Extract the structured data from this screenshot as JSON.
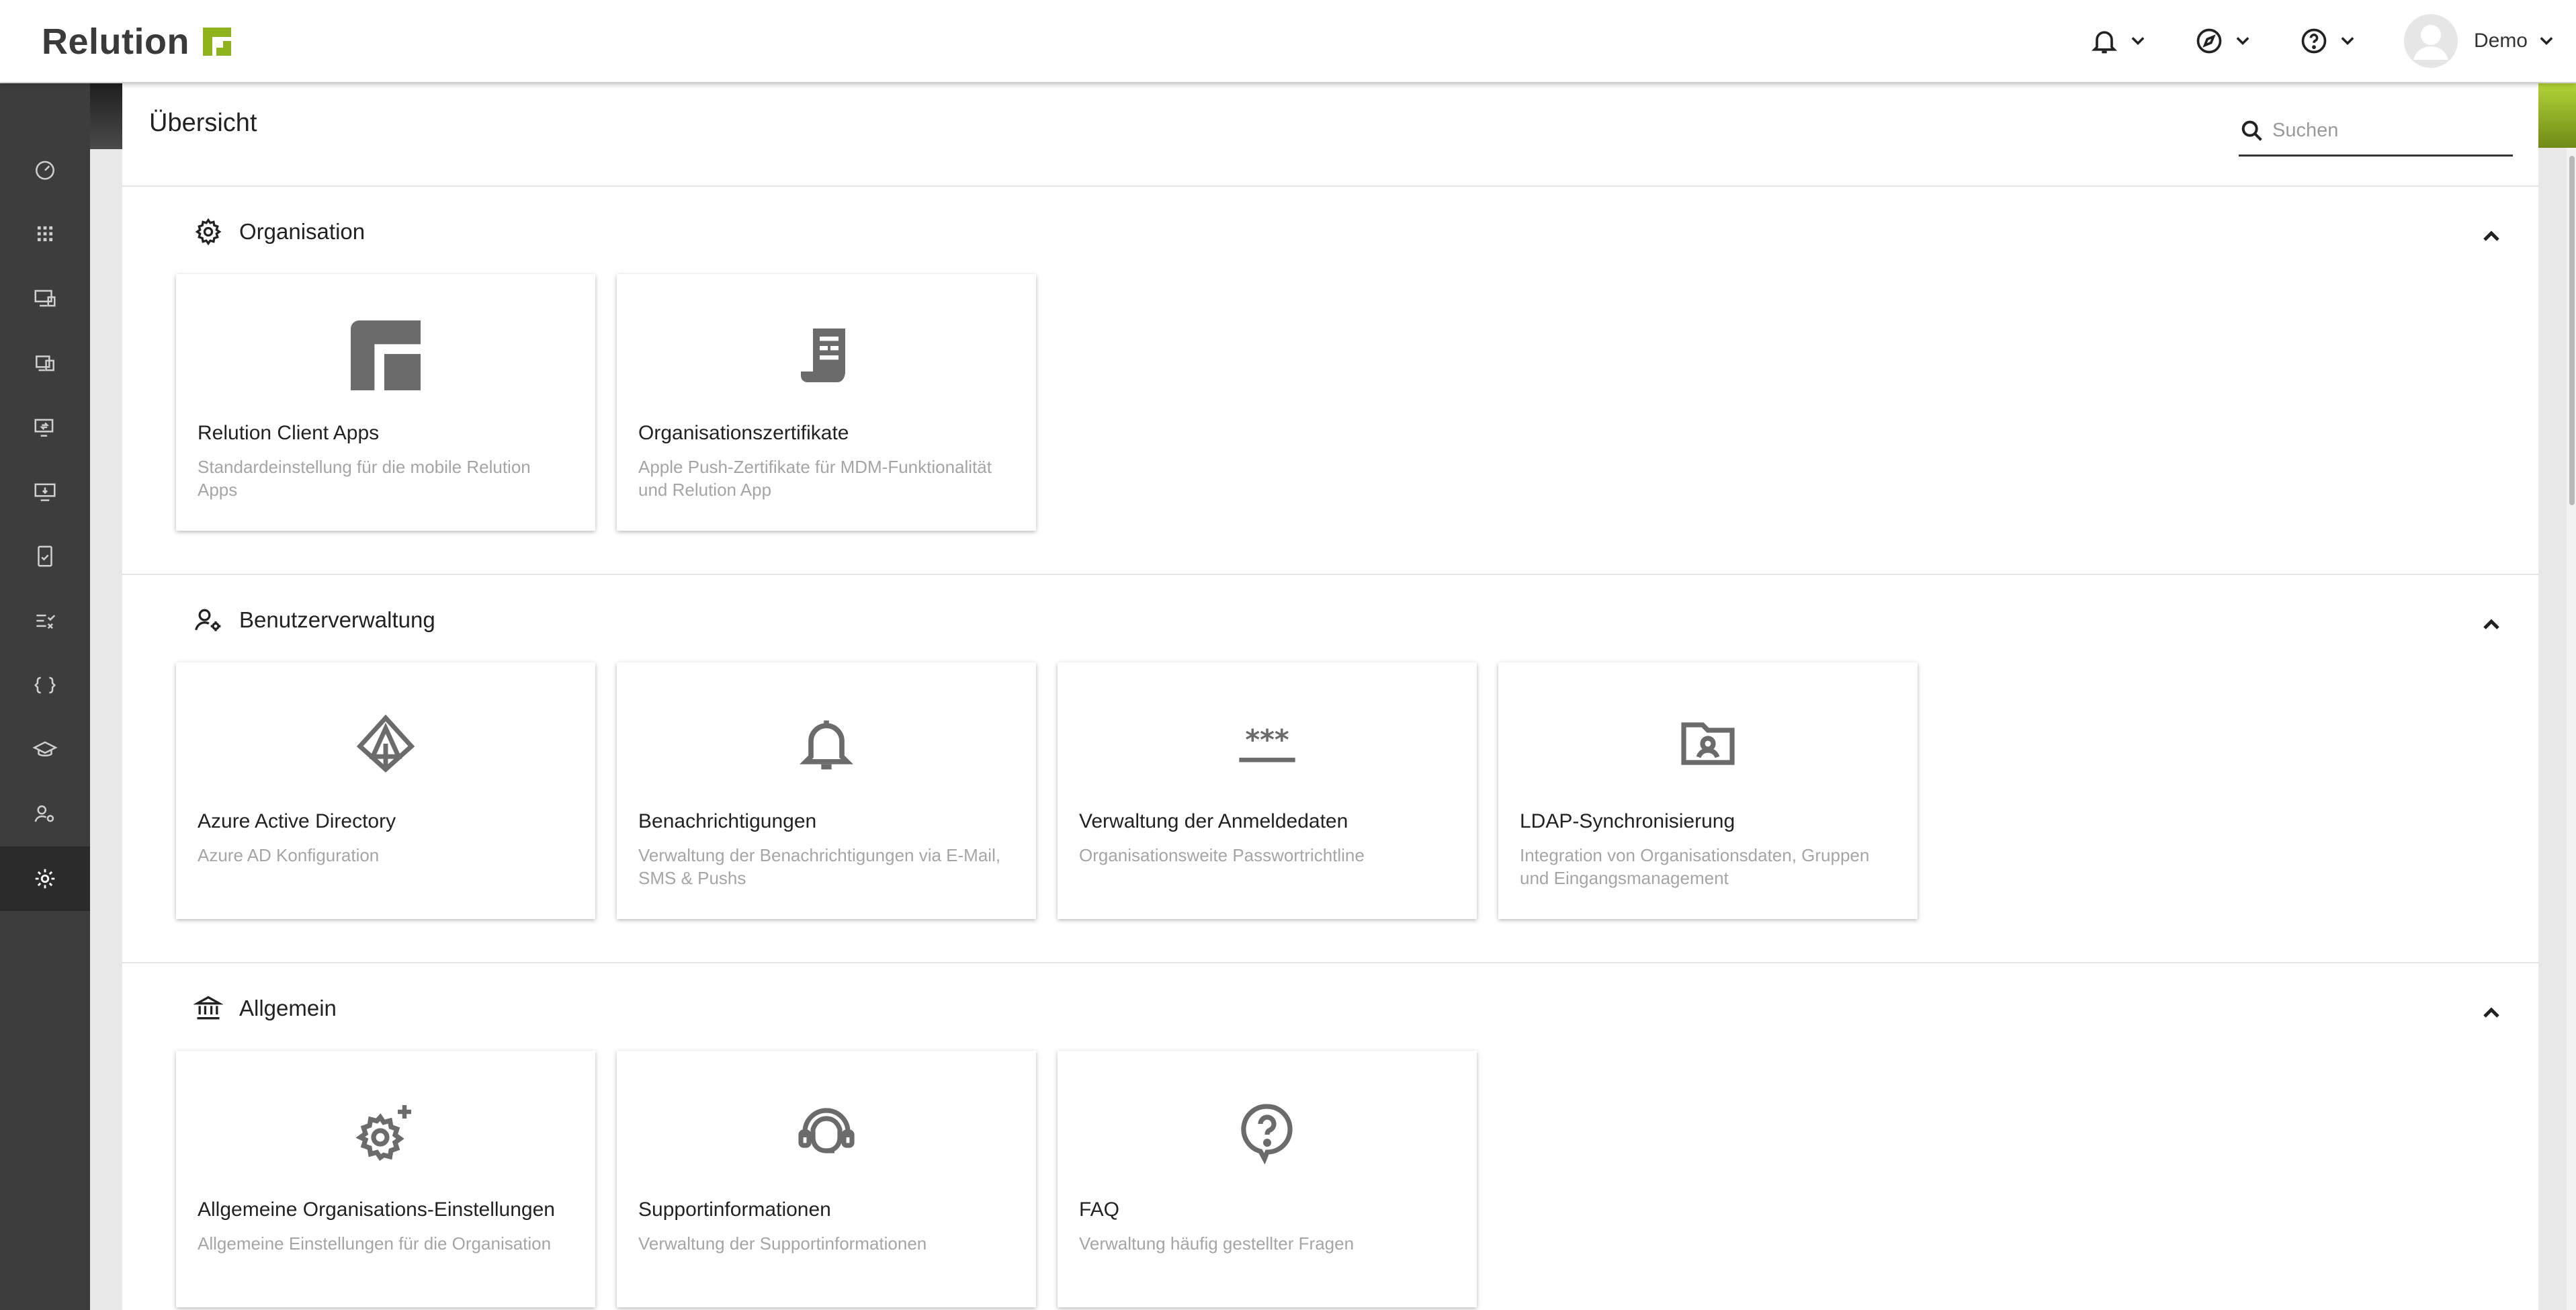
{
  "header": {
    "brand": "Relution",
    "user": "Demo",
    "brand_color": "#8fb31c"
  },
  "sidebar": {
    "items": [
      {
        "icon": "dashboard-icon"
      },
      {
        "icon": "apps-icon"
      },
      {
        "icon": "devices-icon"
      },
      {
        "icon": "inventory-icon"
      },
      {
        "icon": "policies-icon"
      },
      {
        "icon": "enrollment-icon"
      },
      {
        "icon": "compliance-icon"
      },
      {
        "icon": "tasks-icon"
      },
      {
        "icon": "scripts-icon"
      },
      {
        "icon": "education-icon"
      },
      {
        "icon": "users-icon"
      },
      {
        "icon": "settings-icon",
        "active": true
      }
    ]
  },
  "page": {
    "title": "Übersicht",
    "search_placeholder": "Suchen"
  },
  "sections": [
    {
      "title": "Organisation",
      "icon": "gear-icon",
      "cards": [
        {
          "title": "Relution Client Apps",
          "desc": "Standardeinstellung für die mobile Relution Apps",
          "icon": "relution-logo-icon"
        },
        {
          "title": "Organisationszertifikate",
          "desc": "Apple Push-Zertifikate für MDM-Funktionalität und Relution App",
          "icon": "certificate-icon"
        }
      ]
    },
    {
      "title": "Benutzerverwaltung",
      "icon": "user-settings-icon",
      "cards": [
        {
          "title": "Azure Active Directory",
          "desc": "Azure AD Konfiguration",
          "icon": "azure-icon"
        },
        {
          "title": "Benachrichtigungen",
          "desc": "Verwaltung der Benachrichtigungen via E-Mail, SMS & Pushs",
          "icon": "bell-icon"
        },
        {
          "title": "Verwaltung der Anmeldedaten",
          "desc": "Organisationsweite Passwortrichtline",
          "icon": "password-icon"
        },
        {
          "title": "LDAP-Synchronisierung",
          "desc": "Integration von Organisationsdaten, Gruppen und Eingangsmanagement",
          "icon": "folder-user-icon"
        }
      ]
    },
    {
      "title": "Allgemein",
      "icon": "institution-icon",
      "cards": [
        {
          "title": "Allgemeine Organisations-Einstellungen",
          "desc": "Allgemeine Einstellungen für die Organisation",
          "icon": "gear-sparkle-icon"
        },
        {
          "title": "Supportinformationen",
          "desc": "Verwaltung der Supportinformationen",
          "icon": "support-agent-icon"
        },
        {
          "title": "FAQ",
          "desc": "Verwaltung häufig gestellter Fragen",
          "icon": "question-bubble-icon"
        }
      ]
    }
  ]
}
